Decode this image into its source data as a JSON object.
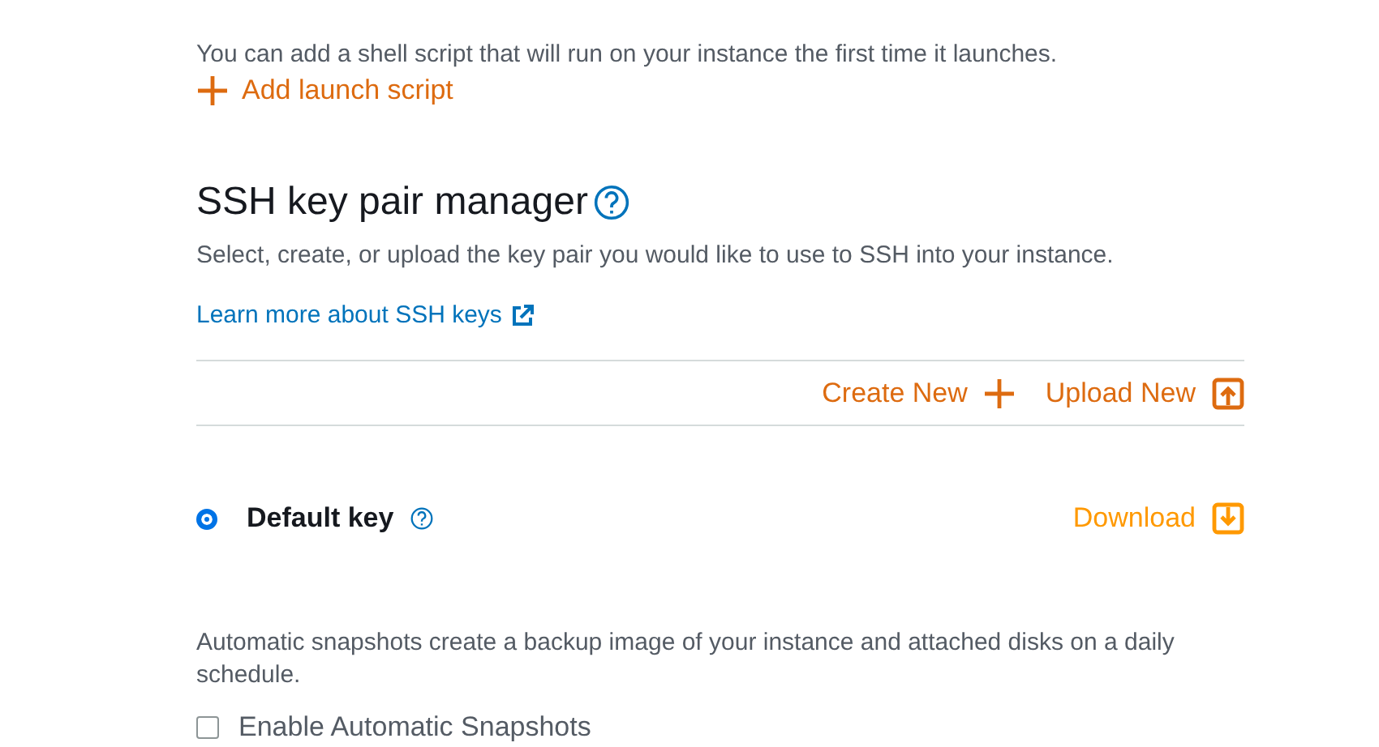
{
  "launch_script": {
    "description": "You can add a shell script that will run on your instance the first time it launches.",
    "add_link": "Add launch script"
  },
  "ssh": {
    "title": "SSH key pair manager",
    "description": "Select, create, or upload the key pair you would like to use to SSH into your instance.",
    "learn_more": "Learn more about SSH keys",
    "actions": [
      "Create New",
      "Upload New"
    ],
    "keys": [
      {
        "name": "Default key",
        "selected": true,
        "action": "Download"
      }
    ]
  },
  "snapshots": {
    "description": "Automatic snapshots create a backup image of your instance and attached disks on a daily schedule.",
    "checkbox": {
      "label": "Enable Automatic Snapshots",
      "checked": false
    }
  }
}
